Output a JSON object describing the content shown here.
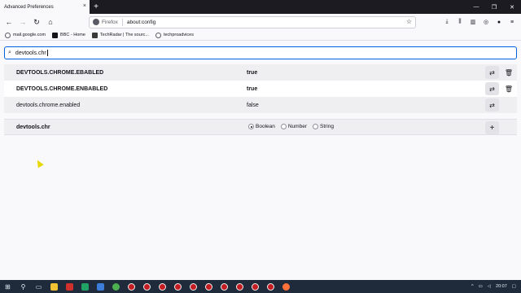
{
  "tab": {
    "title": "Advanced Preferences",
    "close": "×"
  },
  "window": {
    "new_tab": "+",
    "minimize": "—",
    "restore": "❐",
    "close": "✕"
  },
  "nav": {
    "back": "←",
    "forward": "→",
    "reload": "↻",
    "home": "⌂"
  },
  "urlbar": {
    "identity": "Firefox",
    "url": "about:config",
    "star": "☆"
  },
  "tools": {
    "download": "⤓",
    "library": "⫼",
    "sidebar": "▥",
    "sync": "◎",
    "account": "●",
    "menu": "≡"
  },
  "bookmarks": [
    {
      "label": "mail.google.com",
      "icon": "globe-icon"
    },
    {
      "label": "BBC - Home",
      "icon": "bbc-icon"
    },
    {
      "label": "TechRadar | The sourc...",
      "icon": "techradar-icon"
    },
    {
      "label": "techproadvices",
      "icon": "globe-icon"
    }
  ],
  "search": {
    "value": "devtools.chr",
    "icon": "⌕"
  },
  "prefs": [
    {
      "name": "DEVTOOLS.CHROME.EBABLED",
      "value": "true",
      "modified": true
    },
    {
      "name": "DEVTOOLS.CHROME.ENBABLED",
      "value": "true",
      "modified": true
    },
    {
      "name": "devtools.chrome.enabled",
      "value": "false",
      "modified": false
    }
  ],
  "new_pref": {
    "name": "devtools.chr",
    "types": [
      {
        "label": "Boolean",
        "selected": true
      },
      {
        "label": "Number",
        "selected": false
      },
      {
        "label": "String",
        "selected": false
      }
    ],
    "add": "+"
  },
  "glyphs": {
    "toggle": "⇄",
    "reset": "🗑"
  },
  "taskbar": {
    "clock": "20:07"
  }
}
